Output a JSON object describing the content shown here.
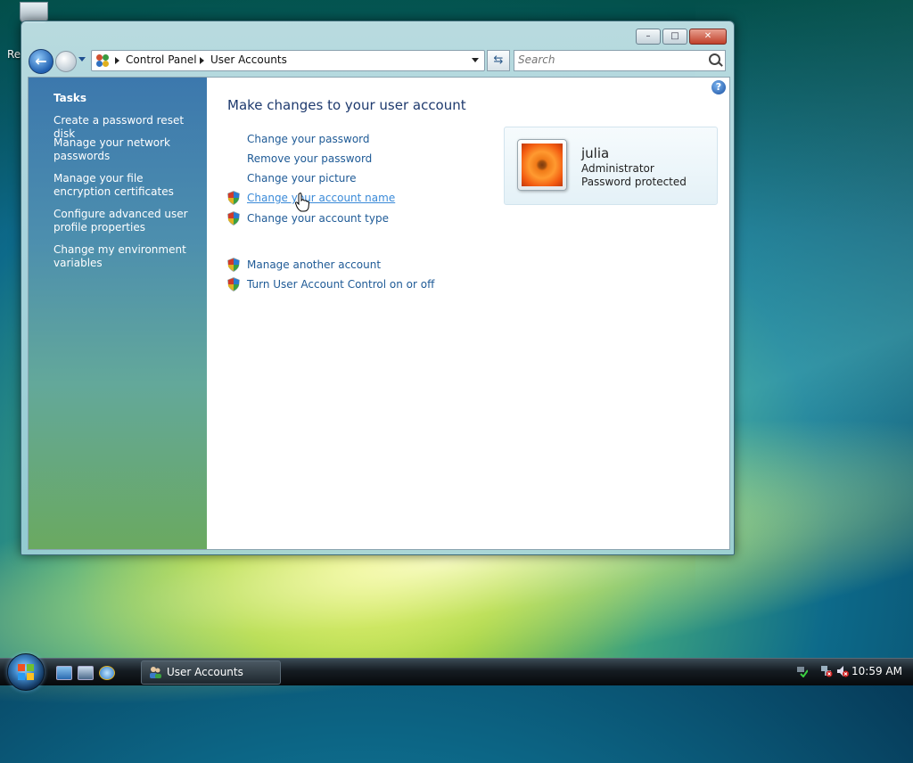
{
  "desktop": {
    "partial_label": "Re"
  },
  "window": {
    "controls": {
      "minimize": "–",
      "maximize": "□",
      "close": "✕"
    },
    "breadcrumb": [
      "Control Panel",
      "User Accounts"
    ],
    "search_placeholder": "Search"
  },
  "sidebar": {
    "heading": "Tasks",
    "links": [
      "Create a password reset disk",
      "Manage your network passwords",
      "Manage your file encryption certificates",
      "Configure advanced user profile properties",
      "Change my environment variables"
    ]
  },
  "main": {
    "title": "Make changes to your user account",
    "tasks": [
      {
        "label": "Change your password",
        "shield": false
      },
      {
        "label": "Remove your password",
        "shield": false
      },
      {
        "label": "Change your picture",
        "shield": false
      },
      {
        "label": "Change your account name",
        "shield": true
      },
      {
        "label": "Change your account type",
        "shield": true
      }
    ],
    "other_tasks": [
      {
        "label": "Manage another account",
        "shield": true
      },
      {
        "label": "Turn User Account Control on or off",
        "shield": true
      }
    ],
    "help": "?"
  },
  "user": {
    "name": "julia",
    "role": "Administrator",
    "status": "Password protected"
  },
  "taskbar": {
    "window_button": "User Accounts",
    "clock": "10:59 AM"
  },
  "colors": {
    "link": "#1e5a96",
    "link_hover": "#3a8ad8",
    "sidebar_top": "#3c78ad",
    "sidebar_bottom": "#6aa960"
  }
}
